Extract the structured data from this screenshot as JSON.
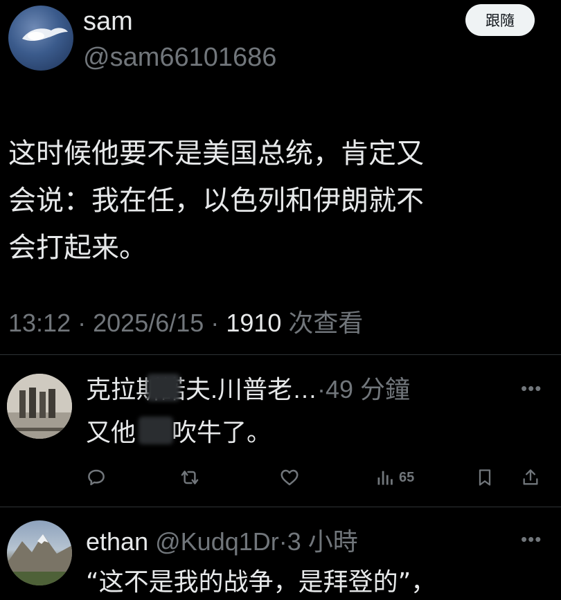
{
  "post": {
    "author_name": "sam",
    "author_handle": "@sam66101686",
    "follow_label": "跟隨",
    "text": "这时候他要不是美国总统，肯定又\n会说：我在任，以色列和伊朗就不\n会打起来。",
    "time": "13:12",
    "sep1": "·",
    "date": "2025/6/15",
    "sep2": "·",
    "views_count": "1910",
    "views_label": "次查看"
  },
  "replies": [
    {
      "name": "克拉斯諾夫.川普老…",
      "sep": "·",
      "age": "49 分鐘",
      "text_before": "又他",
      "text_after": "吹牛了。",
      "more": "•••",
      "actions": {
        "views_count": "65"
      }
    },
    {
      "name": "ethan",
      "handle": "@Kudq1Dr",
      "sep": "·",
      "age": "3 小時",
      "text": "“这不是我的战争，是拜登的”，",
      "more": "•••"
    }
  ],
  "icons": {
    "reply": "reply-icon",
    "retweet": "retweet-icon",
    "like": "heart-icon",
    "views": "views-icon",
    "bookmark": "bookmark-icon",
    "share": "share-icon",
    "more": "more-icon"
  },
  "colors": {
    "background": "#000000",
    "primary_text": "#e7e9ea",
    "secondary_text": "#71767b",
    "divider": "#2f3336",
    "follow_button_bg": "#eff3f4"
  }
}
